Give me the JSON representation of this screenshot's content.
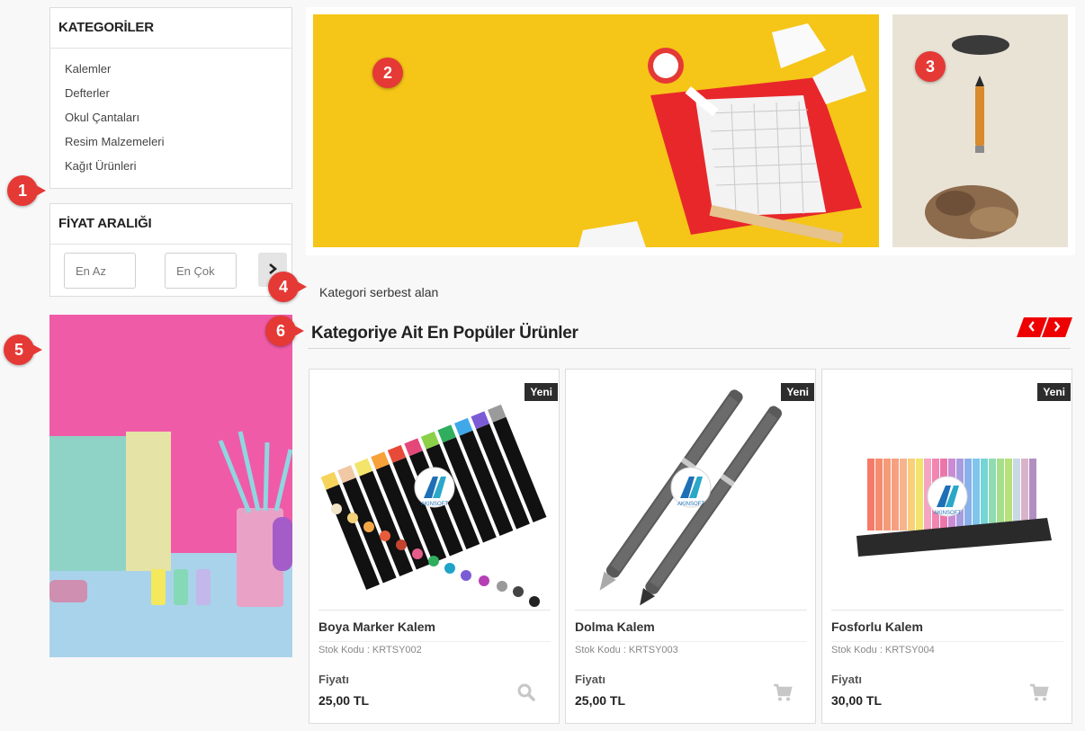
{
  "sidebar": {
    "categories": {
      "title": "KATEGORİLER",
      "items": [
        {
          "label": "Kalemler"
        },
        {
          "label": "Defterler"
        },
        {
          "label": "Okul Çantaları"
        },
        {
          "label": "Resim Malzemeleri"
        },
        {
          "label": "Kağıt Ürünleri"
        }
      ]
    },
    "price_range": {
      "title": "FİYAT ARALIĞI",
      "min_placeholder": "En Az",
      "max_placeholder": "En Çok",
      "submit_icon": "chevron-right-icon"
    }
  },
  "markers": [
    "1",
    "2",
    "3",
    "4",
    "5",
    "6"
  ],
  "free_area_text": "Kategori serbest alan",
  "popular": {
    "title": "Kategoriye Ait En Popüler Ürünler",
    "prev_icon": "chevron-left-icon",
    "next_icon": "chevron-right-icon",
    "products": [
      {
        "badge": "Yeni",
        "name": "Boya Marker Kalem",
        "stock": "Stok Kodu : KRTSY002",
        "price_label": "Fiyatı",
        "price": "25,00 TL",
        "logo": "AKINSOFT",
        "action_icon": "search-icon"
      },
      {
        "badge": "Yeni",
        "name": "Dolma Kalem",
        "stock": "Stok Kodu : KRTSY003",
        "price_label": "Fiyatı",
        "price": "25,00 TL",
        "logo": "AKINSOFT",
        "action_icon": "cart-icon"
      },
      {
        "badge": "Yeni",
        "name": "Fosforlu Kalem",
        "stock": "Stok Kodu : KRTSY004",
        "price_label": "Fiyatı",
        "price": "30,00 TL",
        "logo": "AKINSOFT",
        "action_icon": "cart-icon"
      }
    ]
  },
  "colors": {
    "accent": "#e00000",
    "marker": "#e53935",
    "banner_yellow": "#f5c518",
    "banner_pink": "#f05ba8"
  }
}
